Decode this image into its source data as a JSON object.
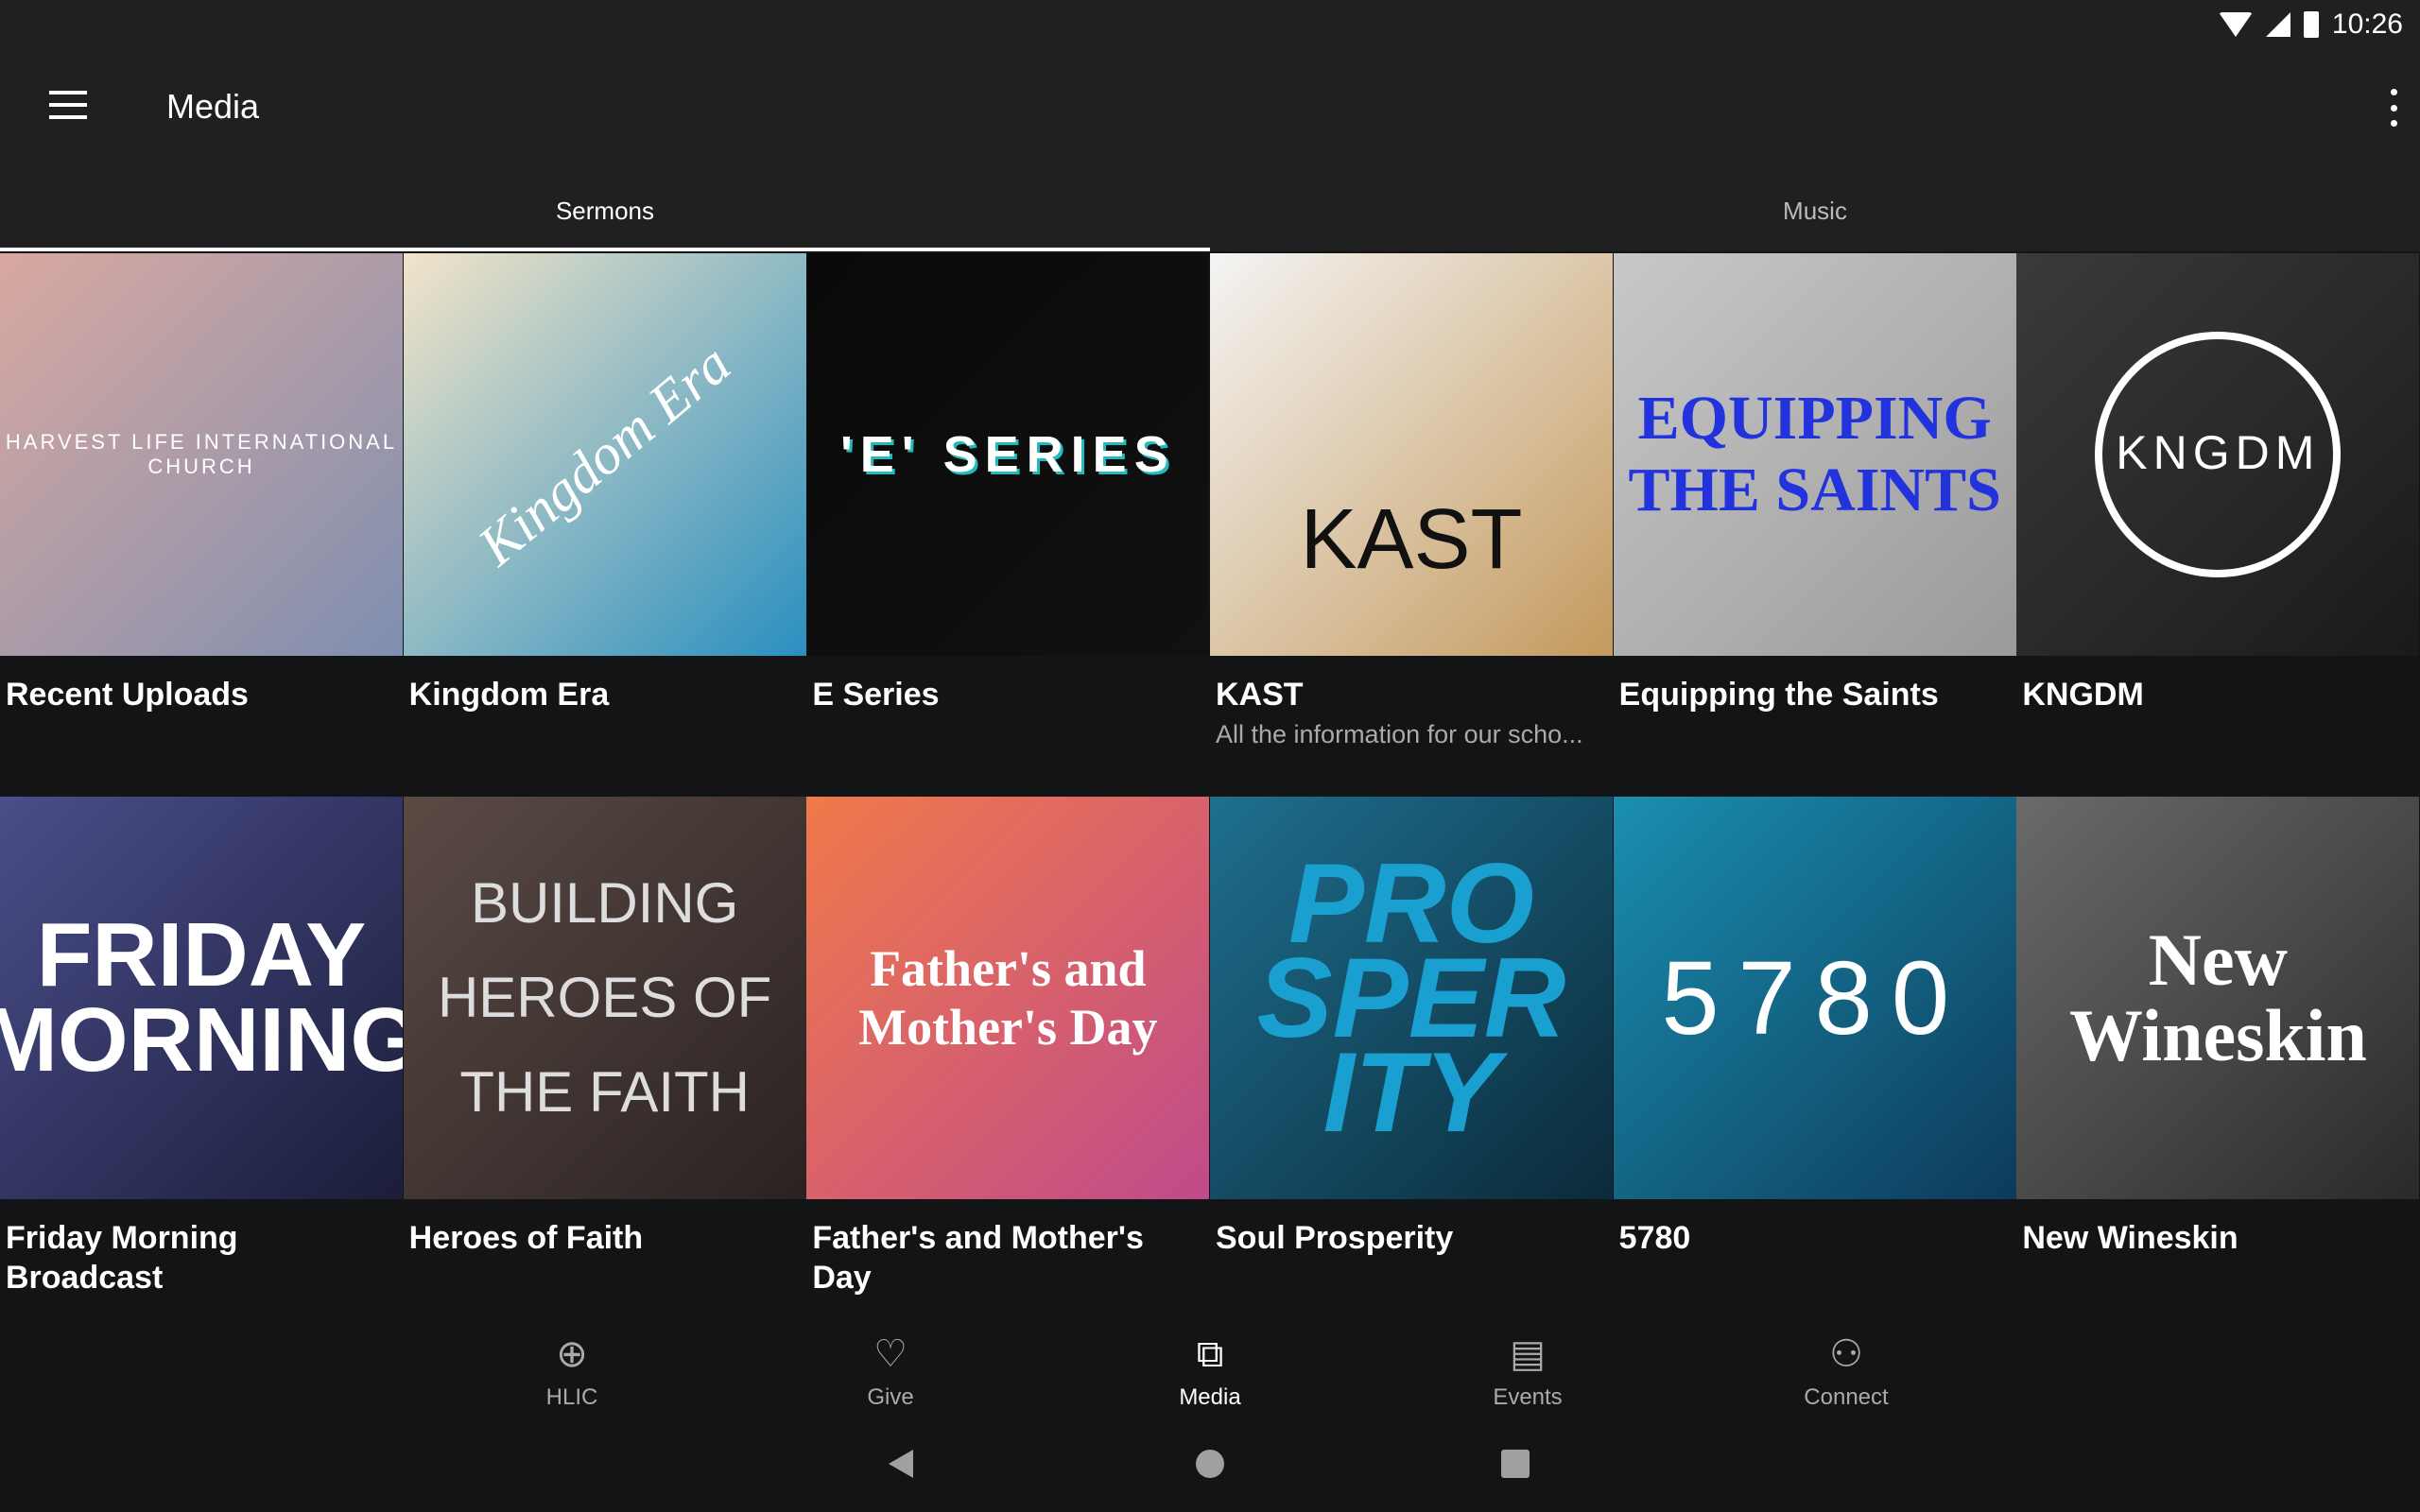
{
  "status_bar": {
    "time": "10:26",
    "icons": [
      "wifi-icon",
      "signal-icon",
      "battery-icon"
    ]
  },
  "app_bar": {
    "title": "Media",
    "menu_icon": "hamburger-icon",
    "overflow_icon": "more-vert-icon"
  },
  "tabs": [
    {
      "label": "Sermons",
      "selected": true
    },
    {
      "label": "Music",
      "selected": false
    }
  ],
  "items": [
    {
      "title": "Recent Uploads",
      "subtitle": "",
      "art_text": "HARVEST LIFE INTERNATIONAL CHURCH",
      "art_colors": [
        "#d9a8a0",
        "#7f8fb0"
      ]
    },
    {
      "title": "Kingdom Era",
      "subtitle": "",
      "art_text": "Kingdom Era",
      "art_colors": [
        "#f2e4c8",
        "#2a8fc0"
      ]
    },
    {
      "title": "E Series",
      "subtitle": "",
      "art_text": "'E' SERIES",
      "art_colors": [
        "#0a0a0a",
        "#111"
      ]
    },
    {
      "title": "KAST",
      "subtitle": "All the information for our scho...",
      "art_text": "KAST",
      "art_colors": [
        "#f4f4f4",
        "#c49a5e"
      ]
    },
    {
      "title": "Equipping the Saints",
      "subtitle": "",
      "art_text": "EQUIPPING THE SAINTS",
      "art_colors": [
        "#c8c8c8",
        "#9a9a9a"
      ]
    },
    {
      "title": "KNGDM",
      "subtitle": "",
      "art_text": "KNGDM",
      "art_colors": [
        "#3a3a3a",
        "#1a1a1a"
      ]
    },
    {
      "title": "Friday Morning Broadcast",
      "subtitle": "",
      "art_text": "FRIDAY MORNING",
      "art_colors": [
        "#4a4e8a",
        "#1b1d3a"
      ]
    },
    {
      "title": "Heroes of Faith",
      "subtitle": "",
      "art_text": "BUILDING HEROES OF THE FAITH",
      "art_colors": [
        "#5a4a44",
        "#2a2222"
      ]
    },
    {
      "title": "Father's and Mother's Day",
      "subtitle": "",
      "art_text": "Father's and Mother's Day",
      "art_colors": [
        "#f07a4a",
        "#c04a8a"
      ]
    },
    {
      "title": "Soul Prosperity",
      "subtitle": "",
      "art_text": "PRO SPER ITY",
      "art_colors": [
        "#1e6f8f",
        "#0b2a3a"
      ]
    },
    {
      "title": "5780",
      "subtitle": "",
      "art_text": "5780",
      "art_colors": [
        "#1a8fb0",
        "#0d3a5a"
      ]
    },
    {
      "title": "New Wineskin",
      "subtitle": "",
      "art_text": "New Wineskin",
      "art_colors": [
        "#6a6a6a",
        "#2a2a2a"
      ]
    }
  ],
  "bottom_nav": [
    {
      "label": "HLIC",
      "icon": "globe-icon",
      "glyph": "⊕",
      "active": false
    },
    {
      "label": "Give",
      "icon": "heart-icon",
      "glyph": "♡",
      "active": false
    },
    {
      "label": "Media",
      "icon": "video-library-icon",
      "glyph": "⧉",
      "active": true
    },
    {
      "label": "Events",
      "icon": "calendar-icon",
      "glyph": "▤",
      "active": false
    },
    {
      "label": "Connect",
      "icon": "connect-icon",
      "glyph": "⚇",
      "active": false
    }
  ]
}
